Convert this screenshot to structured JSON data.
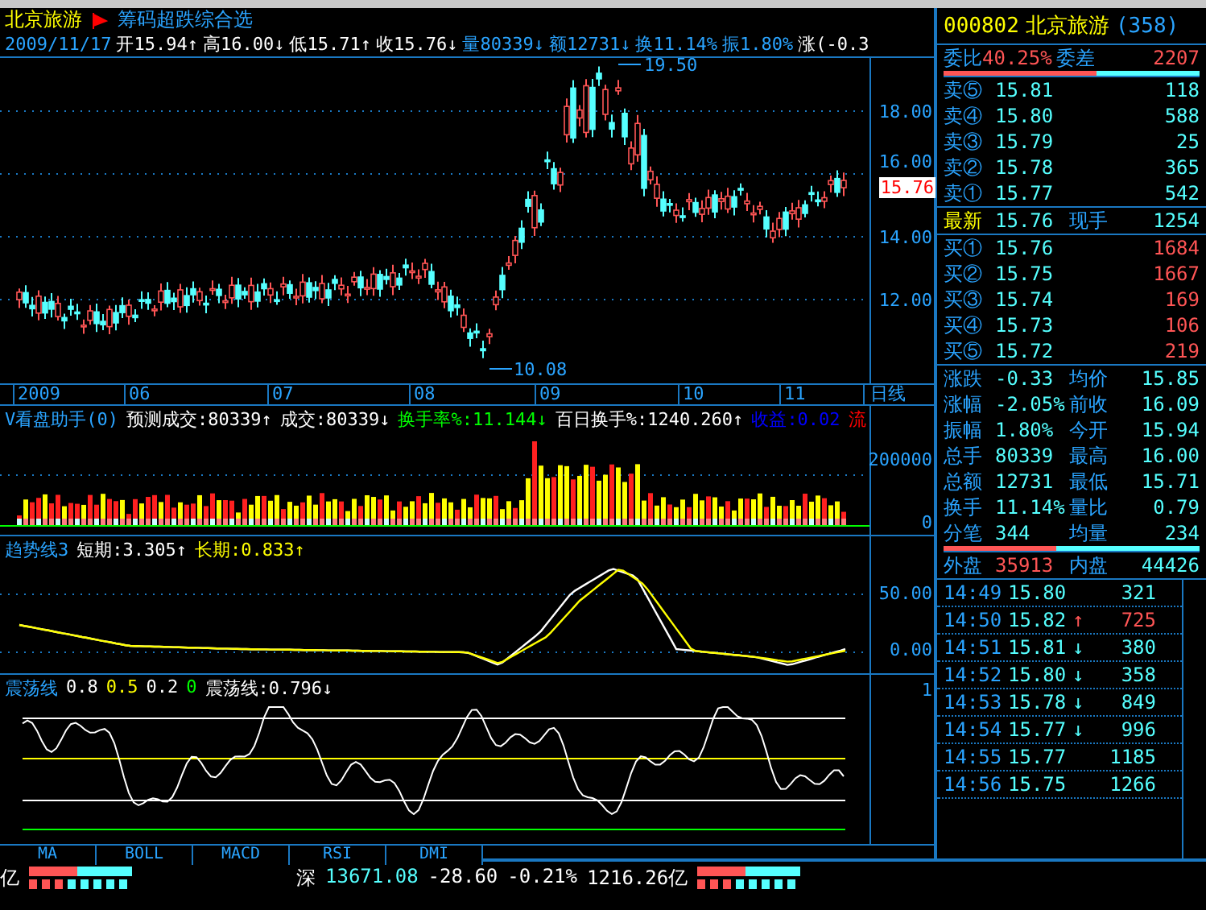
{
  "header": {
    "stock": "北京旅游",
    "formula": "筹码超跌综合选"
  },
  "quote_line": {
    "date": "2009/11/17",
    "items": [
      {
        "text": "开15.94↑",
        "color": "#ffffff"
      },
      {
        "text": "高16.00↓",
        "color": "#ffffff"
      },
      {
        "text": "低15.71↑",
        "color": "#ffffff"
      },
      {
        "text": "收15.76↓",
        "color": "#ffffff"
      },
      {
        "text": "量80339↓",
        "color": "#2aa4ff"
      },
      {
        "text": "额12731↓",
        "color": "#2aa4ff"
      },
      {
        "text": "换11.14%",
        "color": "#2aa4ff"
      },
      {
        "text": "振1.80%",
        "color": "#2aa4ff"
      },
      {
        "text": "涨(-0.3",
        "color": "#ffffff"
      }
    ]
  },
  "price_chart": {
    "axis_labels": [
      "18.00",
      "16.00",
      "14.00",
      "12.00"
    ],
    "current_price": "15.76",
    "high_marker": "19.50",
    "low_marker": "10.08"
  },
  "date_axis": {
    "labels": [
      "2009",
      "06",
      "07",
      "08",
      "09",
      "10",
      "11"
    ],
    "period": "日线"
  },
  "volume_pane": {
    "title": "V看盘助手(0)",
    "items": [
      {
        "text": "预测成交:80339↑",
        "color": "#ffffff"
      },
      {
        "text": "成交:80339↓",
        "color": "#ffffff"
      },
      {
        "text": "换手率%:11.144↓",
        "color": "#00ff00"
      },
      {
        "text": "百日换手%:1240.260↑",
        "color": "#ffffff"
      },
      {
        "text": "收益:0.02",
        "color": "#0000ff"
      },
      {
        "text": "流",
        "color": "#ff0000"
      }
    ],
    "axis_labels": [
      "200000",
      "0"
    ]
  },
  "trend_pane": {
    "title": "趋势线3",
    "items": [
      {
        "text": "短期:3.305↑",
        "color": "#ffffff"
      },
      {
        "text": "长期:0.833↑",
        "color": "#ffff00"
      }
    ],
    "axis_labels": [
      "50.00",
      "0.00"
    ]
  },
  "oscillator_pane": {
    "title": "震荡线",
    "items": [
      {
        "text": "0.8",
        "color": "#ffffff"
      },
      {
        "text": "0.5",
        "color": "#ffff00"
      },
      {
        "text": "0.2",
        "color": "#ffffff"
      },
      {
        "text": "0",
        "color": "#00ff00"
      },
      {
        "text": "震荡线:0.796↓",
        "color": "#ffffff"
      }
    ],
    "axis_labels": [
      "1"
    ]
  },
  "indicator_tabs": [
    {
      "label": "MA",
      "selected": false
    },
    {
      "label": "BOLL",
      "selected": false
    },
    {
      "label": "MACD",
      "selected": false
    },
    {
      "label": "RSI",
      "selected": false
    },
    {
      "label": "DMI",
      "selected": false
    }
  ],
  "status_bar": {
    "left_unit": "亿",
    "market": "深",
    "index": "13671.08",
    "change": "-28.60",
    "percent": "-0.21%",
    "amount": "1216.26亿"
  },
  "quote_panel": {
    "code": "000802",
    "name": "北京旅游",
    "count": "(358)",
    "commission": {
      "ratio_label": "委比",
      "ratio": "40.25%",
      "diff_label": "委差",
      "diff": "2207",
      "level": 0.6
    },
    "sells": [
      {
        "label": "卖⑤",
        "price": "15.81",
        "volume": "118"
      },
      {
        "label": "卖④",
        "price": "15.80",
        "volume": "588"
      },
      {
        "label": "卖③",
        "price": "15.79",
        "volume": "25"
      },
      {
        "label": "卖②",
        "price": "15.78",
        "volume": "365"
      },
      {
        "label": "卖①",
        "price": "15.77",
        "volume": "542"
      }
    ],
    "latest": {
      "label": "最新",
      "price": "15.76",
      "hand_label": "现手",
      "hand": "1254"
    },
    "buys": [
      {
        "label": "买①",
        "price": "15.76",
        "volume": "1684"
      },
      {
        "label": "买②",
        "price": "15.75",
        "volume": "1667"
      },
      {
        "label": "买③",
        "price": "15.74",
        "volume": "169"
      },
      {
        "label": "买④",
        "price": "15.73",
        "volume": "106"
      },
      {
        "label": "买⑤",
        "price": "15.72",
        "volume": "219"
      }
    ],
    "stats": [
      [
        "涨跌",
        "-0.33",
        "均价",
        "15.85"
      ],
      [
        "涨幅",
        "-2.05%",
        "前收",
        "16.09"
      ],
      [
        "振幅",
        "1.80%",
        "今开",
        "15.94"
      ],
      [
        "总手",
        "80339",
        "最高",
        "16.00"
      ],
      [
        "总额",
        "12731",
        "最低",
        "15.71"
      ],
      [
        "换手",
        "11.14%",
        "量比",
        "0.79"
      ],
      [
        "分笔",
        "344",
        "均量",
        "234"
      ]
    ],
    "outer_inner": {
      "outer_label": "外盘",
      "outer": "35913",
      "inner_label": "内盘",
      "inner": "44426",
      "level": 0.44
    },
    "ticks": [
      {
        "time": "14:49",
        "price": "15.80",
        "volume": "321",
        "color": "#55ffff"
      },
      {
        "time": "14:50",
        "price": "15.82",
        "arrow": "↑",
        "volume": "725",
        "color": "#ff5555"
      },
      {
        "time": "14:51",
        "price": "15.81",
        "arrow": "↓",
        "volume": "380",
        "color": "#55ffff"
      },
      {
        "time": "14:52",
        "price": "15.80",
        "arrow": "↓",
        "volume": "358",
        "color": "#55ffff"
      },
      {
        "time": "14:53",
        "price": "15.78",
        "arrow": "↓",
        "volume": "849",
        "color": "#55ffff"
      },
      {
        "time": "14:54",
        "price": "15.77",
        "arrow": "↓",
        "volume": "996",
        "color": "#55ffff"
      },
      {
        "time": "14:55",
        "price": "15.77",
        "volume": "1185",
        "color": "#55ffff"
      },
      {
        "time": "14:56",
        "price": "15.75",
        "volume": "1266",
        "color": "#55ffff"
      }
    ]
  }
}
